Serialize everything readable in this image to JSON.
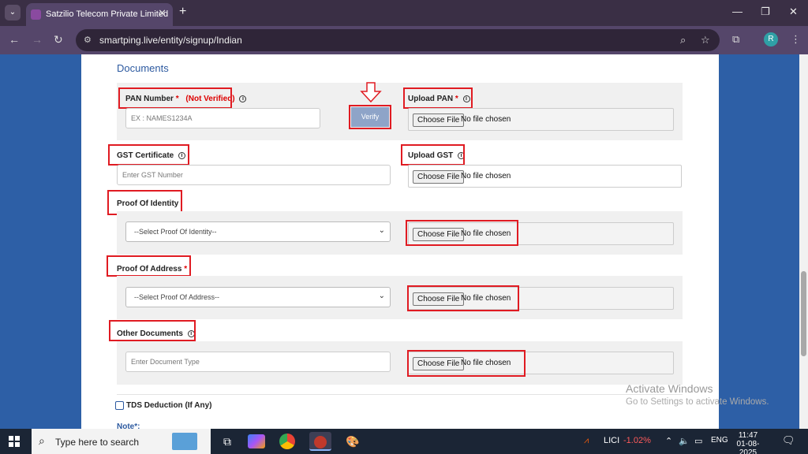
{
  "browser": {
    "tab_title": "Satzilio Telecom Private Limited",
    "url": "smartping.live/entity/signup/Indian",
    "profile_initial": "R"
  },
  "form": {
    "section_title": "Documents",
    "pan": {
      "label": "PAN Number",
      "required_mark": "*",
      "status": "(Not Verified)",
      "placeholder": "EX : NAMES1234A",
      "verify_label": "Verify"
    },
    "upload_pan": {
      "label": "Upload PAN",
      "required_mark": "*"
    },
    "gst": {
      "label": "GST Certificate",
      "placeholder": "Enter GST Number"
    },
    "upload_gst": {
      "label": "Upload GST"
    },
    "identity": {
      "label": "Proof Of Identity",
      "select_value": "--Select Proof Of Identity--"
    },
    "address": {
      "label": "Proof Of Address",
      "required_mark": "*",
      "select_value": "--Select Proof Of Address--"
    },
    "other": {
      "label": "Other Documents",
      "placeholder": "Enter Document Type"
    },
    "file": {
      "choose_label": "Choose File",
      "no_file_text": "No file chosen"
    },
    "tds_label": "TDS Deduction (If Any)",
    "note_label": "Note*:"
  },
  "watermark": {
    "line1": "Activate Windows",
    "line2": "Go to Settings to activate Windows."
  },
  "taskbar": {
    "search_placeholder": "Type here to search",
    "stock_name": "LICI",
    "stock_change": "-1.02%",
    "language": "ENG",
    "time": "11:47",
    "date": "01-08-2025"
  },
  "colors": {
    "accent": "#2d5aa0",
    "required": "#dd0000",
    "highlight_box": "#e01b22",
    "verify_bg": "#8ea4c8"
  }
}
